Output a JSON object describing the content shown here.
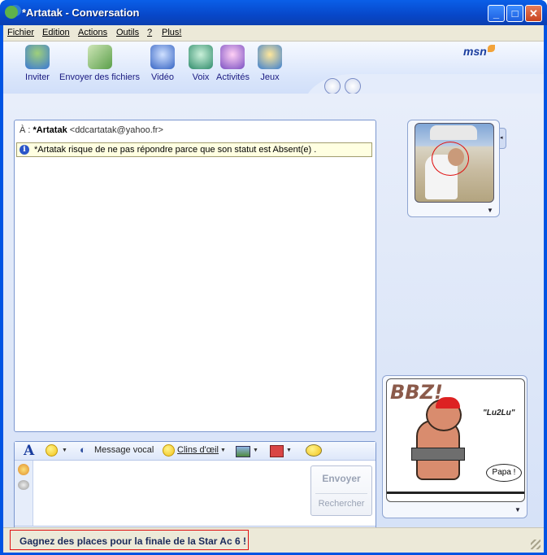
{
  "window": {
    "title": "*Artatak - Conversation",
    "buttons": {
      "minimize": "_",
      "maximize": "□",
      "close": "✕"
    }
  },
  "menu": [
    "Fichier",
    "Edition",
    "Actions",
    "Outils",
    "?",
    "Plus!"
  ],
  "toolbar": {
    "items": [
      {
        "label": "Inviter",
        "icon": "invite-icon",
        "color": "#3a78d6"
      },
      {
        "label": "Envoyer des fichiers",
        "icon": "send-files-icon",
        "color": "#5b9f4a"
      },
      {
        "label": "Vidéo",
        "icon": "webcam-icon",
        "color": "#3564c4"
      },
      {
        "label": "Voix",
        "icon": "voice-icon",
        "color": "#2f8c6b"
      },
      {
        "label": "Activités",
        "icon": "activities-icon",
        "color": "#7a4fc2"
      },
      {
        "label": "Jeux",
        "icon": "games-icon",
        "color": "#3b7fd0"
      }
    ],
    "brand": "msn"
  },
  "conversation": {
    "to_prefix": "À :",
    "contact_name": "*Artatak",
    "contact_email": "<ddcartatak@yahoo.fr>",
    "notice": "*Artatak risque de ne pas répondre parce que son statut est Absent(e) ."
  },
  "compose": {
    "voice_message": "Message vocal",
    "winks": "Clins d'œil",
    "send": "Envoyer",
    "search": "Rechercher",
    "input_value": ""
  },
  "display_pics": {
    "contact_caption": "",
    "my_pic_text": {
      "title": "BBZ!",
      "tag": "\"Lu2Lu\"",
      "bubble": "Papa !"
    }
  },
  "status_bar": {
    "ad_text": "Gagnez des places pour la finale de la Star Ac 6 !"
  }
}
